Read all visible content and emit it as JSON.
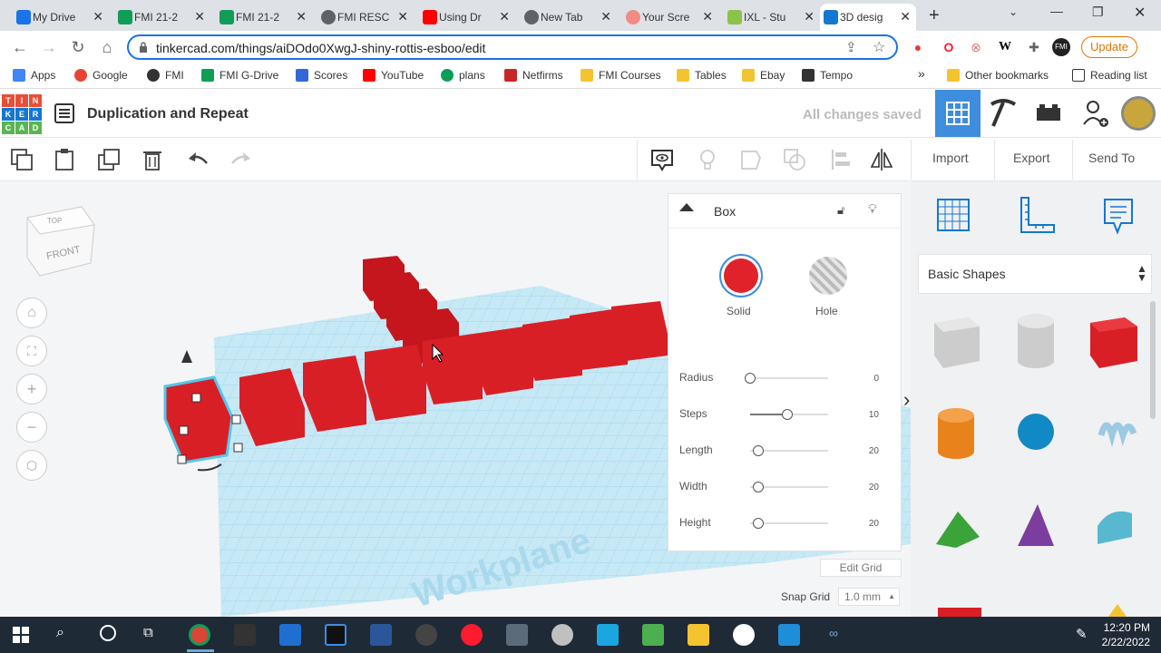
{
  "browser": {
    "tabs": [
      {
        "label": "My Drive",
        "color": "#1a73e8"
      },
      {
        "label": "FMI 21-2",
        "color": "#0f9d58"
      },
      {
        "label": "FMI 21-2",
        "color": "#0f9d58"
      },
      {
        "label": "FMI RESC",
        "color": "#5f6368"
      },
      {
        "label": "Using Dr",
        "color": "#ff0000"
      },
      {
        "label": "New Tab",
        "color": "#5f6368"
      },
      {
        "label": "Your Scre",
        "color": "#e8710a"
      },
      {
        "label": "IXL - Stu",
        "color": "#8bc34a"
      },
      {
        "label": "3D desig",
        "color": "#1477d1"
      }
    ],
    "url": "tinkercad.com/things/aiDOdo0XwgJ-shiny-rottis-esboo/edit",
    "update_label": "Update",
    "bookmarks": [
      {
        "label": "Apps",
        "color": "#4285f4"
      },
      {
        "label": "Google",
        "color": "#ea4335"
      },
      {
        "label": "FMI",
        "color": "#333333"
      },
      {
        "label": "FMI G-Drive",
        "color": "#0f9d58"
      },
      {
        "label": "Scores",
        "color": "#3367d6"
      },
      {
        "label": "YouTube",
        "color": "#ff0000"
      },
      {
        "label": "plans",
        "color": "#0f9d58"
      },
      {
        "label": "Netfirms",
        "color": "#c62828"
      },
      {
        "label": "FMI Courses",
        "color": "#f4c430"
      },
      {
        "label": "Tables",
        "color": "#f4c430"
      },
      {
        "label": "Ebay",
        "color": "#f4c430"
      },
      {
        "label": "Tempo",
        "color": "#333333"
      }
    ],
    "more_bookmarks": "»",
    "other_bookmarks": "Other bookmarks",
    "reading_list": "Reading list"
  },
  "header": {
    "logo_letters": [
      "TIN",
      "KER",
      "CAD"
    ],
    "title": "Duplication and Repeat",
    "save_status": "All changes saved"
  },
  "toolbar": {
    "import_label": "Import",
    "export_label": "Export",
    "sendto_label": "Send To"
  },
  "viewcube": {
    "top": "TOP",
    "front": "FRONT"
  },
  "workplane_label": "Workplane",
  "inspector": {
    "shape_name": "Box",
    "solid_label": "Solid",
    "hole_label": "Hole",
    "solid_color": "#e0222a",
    "params": [
      {
        "label": "Radius",
        "value": "0",
        "fraction": 0.0
      },
      {
        "label": "Steps",
        "value": "10",
        "fraction": 0.45
      },
      {
        "label": "Length",
        "value": "20",
        "fraction": 0.08
      },
      {
        "label": "Width",
        "value": "20",
        "fraction": 0.08
      },
      {
        "label": "Height",
        "value": "20",
        "fraction": 0.08
      }
    ]
  },
  "grid": {
    "edit_grid_label": "Edit Grid",
    "snap_grid_label": "Snap Grid",
    "snap_value": "1.0 mm"
  },
  "library": {
    "category": "Basic Shapes"
  },
  "taskbar": {
    "time": "12:20 PM",
    "date": "2/22/2022"
  }
}
